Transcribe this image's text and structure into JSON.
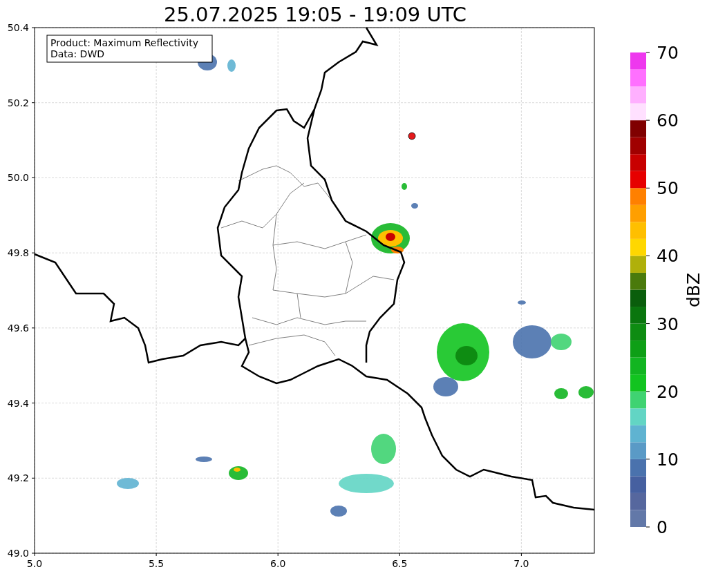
{
  "title": "25.07.2025 19:05 - 19:09 UTC",
  "legend": [
    "Product: Maximum Reflectivity",
    "Data: DWD"
  ],
  "map": {
    "x_ticks": [
      "5.0",
      "5.5",
      "6.0",
      "6.5",
      "7.0"
    ],
    "y_ticks": [
      "50.4",
      "50.2",
      "50.0",
      "49.8",
      "49.6",
      "49.4",
      "49.2",
      "49.0"
    ]
  },
  "colorbar": {
    "label": "dBZ",
    "ticks": [
      "70",
      "60",
      "50",
      "40",
      "30",
      "20",
      "10",
      "0"
    ],
    "bands": [
      {
        "color": "#6278a8"
      },
      {
        "color": "#56679e"
      },
      {
        "color": "#4660a0"
      },
      {
        "color": "#4a72ad"
      },
      {
        "color": "#5a9ac6"
      },
      {
        "color": "#5fb3d1"
      },
      {
        "color": "#62d5c4"
      },
      {
        "color": "#3fd371"
      },
      {
        "color": "#12c420"
      },
      {
        "color": "#12b521"
      },
      {
        "color": "#0e9f16"
      },
      {
        "color": "#0e8c12"
      },
      {
        "color": "#0a760e"
      },
      {
        "color": "#0a5e0c"
      },
      {
        "color": "#4a7a0c"
      },
      {
        "color": "#b0b00a"
      },
      {
        "color": "#ffd700"
      },
      {
        "color": "#ffbf00"
      },
      {
        "color": "#ff9f00"
      },
      {
        "color": "#ff8000"
      },
      {
        "color": "#e60000"
      },
      {
        "color": "#c80000"
      },
      {
        "color": "#a00000"
      },
      {
        "color": "#800000"
      },
      {
        "color": "#ffe0ff"
      },
      {
        "color": "#ffb0ff"
      },
      {
        "color": "#ff70ff"
      },
      {
        "color": "#ee38ee"
      }
    ]
  }
}
